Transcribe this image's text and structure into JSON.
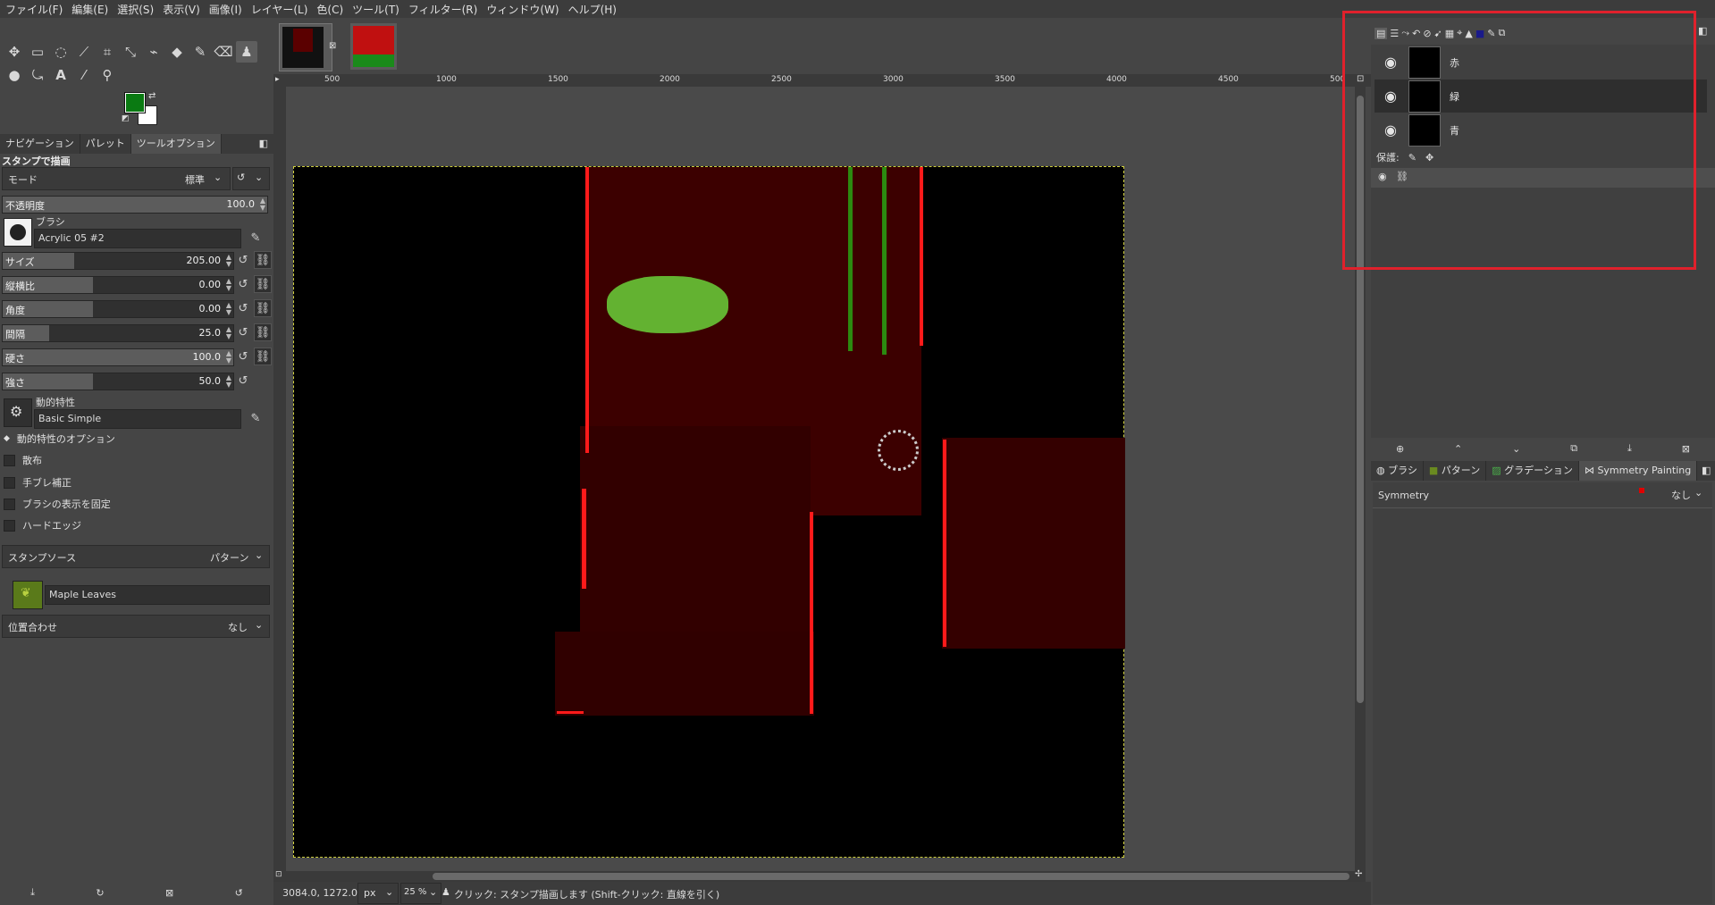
{
  "menu": [
    "ファイル(F)",
    "編集(E)",
    "選択(S)",
    "表示(V)",
    "画像(I)",
    "レイヤー(L)",
    "色(C)",
    "ツール(T)",
    "フィルター(R)",
    "ウィンドウ(W)",
    "ヘルプ(H)"
  ],
  "left_tabs": [
    "ナビゲーション",
    "パレット",
    "ツールオプション"
  ],
  "tool_options": {
    "title": "スタンプで描画",
    "mode_label": "モード",
    "mode_value": "標準",
    "opacity_label": "不透明度",
    "opacity_value": "100.0",
    "brush_label": "ブラシ",
    "brush_name": "Acrylic 05 #2",
    "sliders": [
      {
        "label": "サイズ",
        "value": "205.00",
        "fill": 0.31
      },
      {
        "label": "縦横比",
        "value": "0.00",
        "fill": 0.39
      },
      {
        "label": "角度",
        "value": "0.00",
        "fill": 0.39
      },
      {
        "label": "間隔",
        "value": "25.0",
        "fill": 0.2
      },
      {
        "label": "硬さ",
        "value": "100.0",
        "fill": 1.0
      },
      {
        "label": "強さ",
        "value": "50.0",
        "fill": 0.39
      }
    ],
    "dynamics_label": "動的特性",
    "dynamics_value": "Basic Simple",
    "dynamics_options": "動的特性のオプション",
    "checks": [
      "散布",
      "手ブレ補正",
      "ブラシの表示を固定",
      "ハードエッジ"
    ],
    "source_label": "スタンプソース",
    "source_value": "パターン",
    "pattern_name": "Maple Leaves",
    "alignment_label": "位置合わせ",
    "alignment_value": "なし"
  },
  "ruler": {
    "h_ticks": [
      "500",
      "1000",
      "1500",
      "2000",
      "2500",
      "3000",
      "3500",
      "4000",
      "4500",
      "500"
    ]
  },
  "status": {
    "coords": "3084.0, 1272.0",
    "unit": "px",
    "zoom": "25 %",
    "message": "クリック: スタンプ描画します (Shift-クリック: 直線を引く)"
  },
  "layers": [
    {
      "name": "赤"
    },
    {
      "name": "緑"
    },
    {
      "name": "青"
    }
  ],
  "lock_label": "保護:",
  "bottom_tabs": [
    "ブラシ",
    "パターン",
    "グラデーション",
    "Symmetry Painting"
  ],
  "symmetry": {
    "label": "Symmetry",
    "value": "なし"
  },
  "colors": {
    "fg": "#0a7a12",
    "bg": "#ffffff",
    "highlight": "#e0212c",
    "accent_red": "#ff1a1a"
  }
}
